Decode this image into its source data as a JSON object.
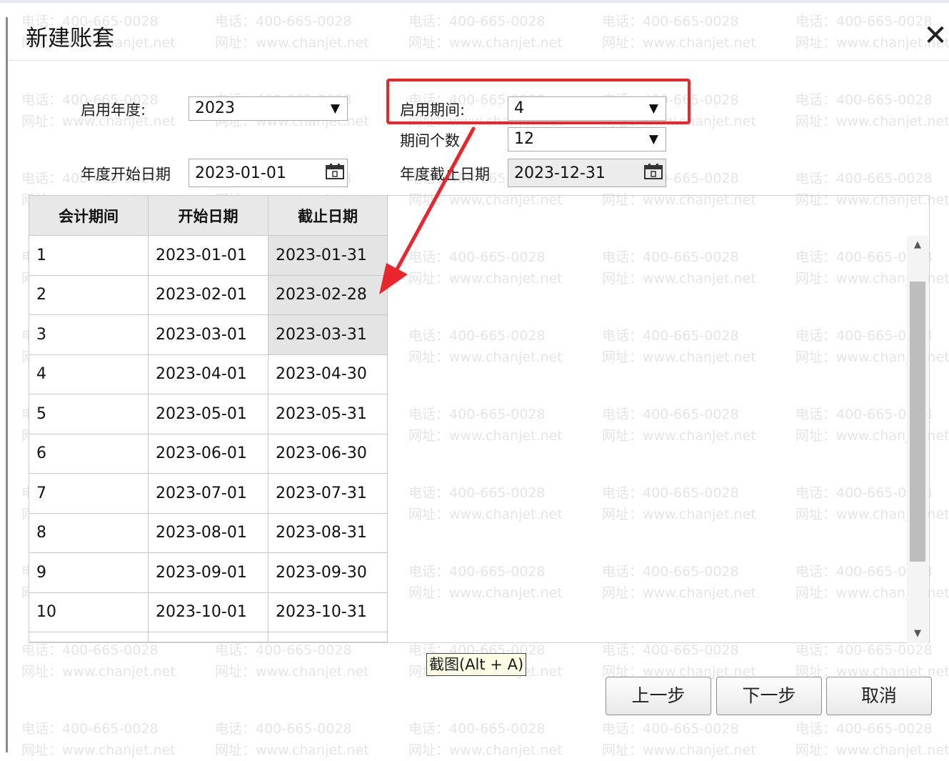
{
  "dialog": {
    "title": "新建账套",
    "close": "✕"
  },
  "form": {
    "start_year_label": "启用年度:",
    "start_year_value": "2023",
    "start_period_label": "启用期间:",
    "start_period_value": "4",
    "period_count_label": "期间个数",
    "period_count_value": "12",
    "year_start_label": "年度开始日期",
    "year_start_value": "2023-01-01",
    "year_end_label": "年度截止日期",
    "year_end_value": "2023-12-31"
  },
  "table": {
    "headers": [
      "会计期间",
      "开始日期",
      "截止日期"
    ],
    "rows": [
      [
        "1",
        "2023-01-01",
        "2023-01-31"
      ],
      [
        "2",
        "2023-02-01",
        "2023-02-28"
      ],
      [
        "3",
        "2023-03-01",
        "2023-03-31"
      ],
      [
        "4",
        "2023-04-01",
        "2023-04-30"
      ],
      [
        "5",
        "2023-05-01",
        "2023-05-31"
      ],
      [
        "6",
        "2023-06-01",
        "2023-06-30"
      ],
      [
        "7",
        "2023-07-01",
        "2023-07-31"
      ],
      [
        "8",
        "2023-08-01",
        "2023-08-31"
      ],
      [
        "9",
        "2023-09-01",
        "2023-09-30"
      ],
      [
        "10",
        "2023-10-01",
        "2023-10-31"
      ]
    ]
  },
  "tooltip": "截图(Alt + A)",
  "buttons": {
    "prev": "上一步",
    "next": "下一步",
    "cancel": "取消"
  },
  "watermark": {
    "phone": "电话：400-665-0028",
    "site": "网址：www.chanjet.net"
  },
  "colors": {
    "highlight_red": "#e8262b",
    "selected_cell": "#e4e4e4"
  },
  "icons": {
    "dropdown": "triangle-down-icon",
    "date": "calendar-icon",
    "close": "close-icon"
  }
}
